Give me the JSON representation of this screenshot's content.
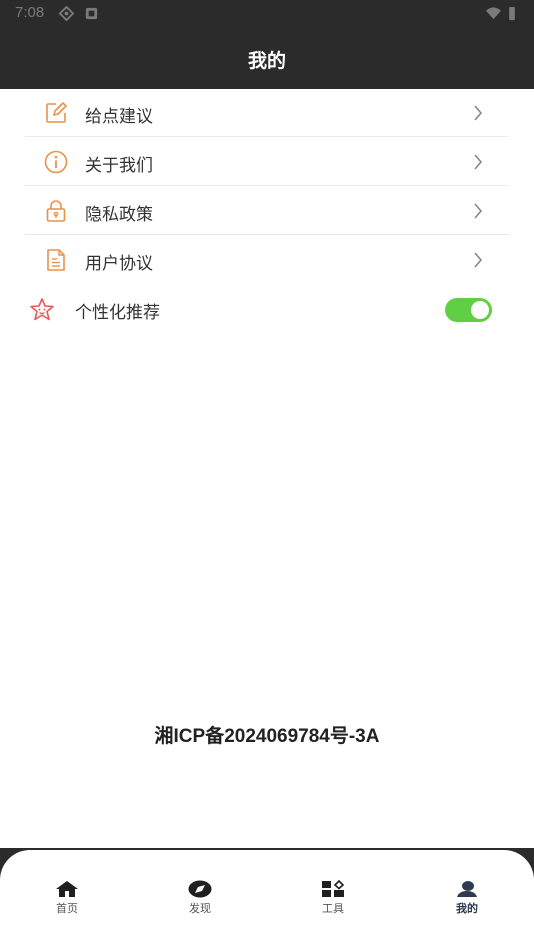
{
  "status_bar": {
    "time": "7:08"
  },
  "header": {
    "title": "我的"
  },
  "menu": {
    "items": [
      {
        "label": "给点建议",
        "icon": "edit-icon"
      },
      {
        "label": "关于我们",
        "icon": "info-icon"
      },
      {
        "label": "隐私政策",
        "icon": "lock-icon"
      },
      {
        "label": "用户协议",
        "icon": "document-icon"
      }
    ],
    "personalized": {
      "label": "个性化推荐",
      "enabled": true
    }
  },
  "footer": {
    "icp": "湘ICP备2024069784号-3A"
  },
  "tabs": [
    {
      "label": "首页",
      "icon": "home-icon",
      "active": false
    },
    {
      "label": "发现",
      "icon": "compass-icon",
      "active": false
    },
    {
      "label": "工具",
      "icon": "tools-icon",
      "active": false
    },
    {
      "label": "我的",
      "icon": "profile-icon",
      "active": true
    }
  ],
  "colors": {
    "header_bg": "#2b2b2b",
    "icon_accent": "#e8924a",
    "toggle_on": "#61cf45",
    "active_tab": "#2f3a4f"
  }
}
